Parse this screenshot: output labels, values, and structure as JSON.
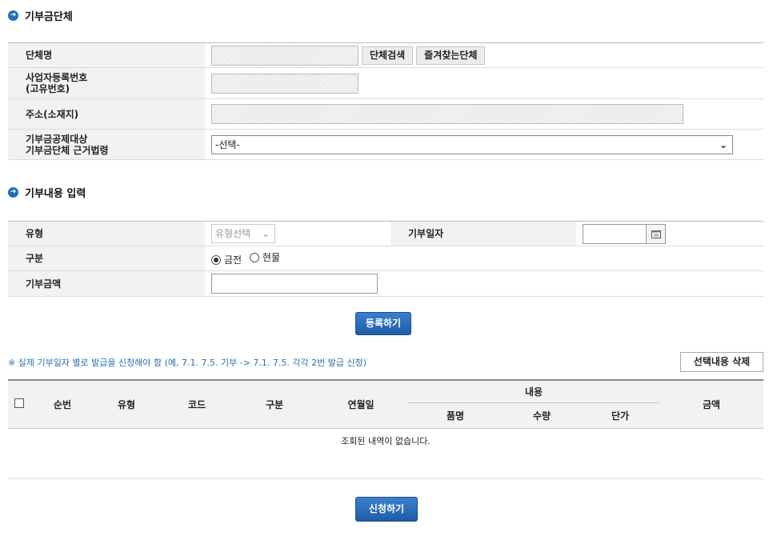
{
  "org_section": {
    "title": "기부금단체",
    "org_name_label": "단체명",
    "search_button": "단체검색",
    "favorites_button": "즐겨찾는단체",
    "biz_no_label_1": "사업자등록번호",
    "biz_no_label_2": "(고유번호)",
    "address_label": "주소(소재지)",
    "legal_basis_label_1": "기부금공제대상",
    "legal_basis_label_2": "기부금단체 근거법령",
    "legal_basis_value": "-선택-"
  },
  "donation_section": {
    "title": "기부내용 입력",
    "type_label": "유형",
    "type_placeholder": "유형선택",
    "date_label": "기부일자",
    "category_label": "구분",
    "category_options": [
      "금전",
      "현물"
    ],
    "category_selected": "금전",
    "amount_label": "기부금액",
    "register_button": "등록하기"
  },
  "list_section": {
    "notice": "※ 실제 기부일자 별로 발급을 신청해야 함 (예, 7.1. 7.5. 기부 -> 7.1. 7.5. 각각 2번 발급 신청)",
    "delete_button": "선택내용 삭제",
    "columns": {
      "seq": "순번",
      "type": "유형",
      "code": "코드",
      "category": "구분",
      "date": "연월일",
      "content": "내용",
      "item": "품명",
      "quantity": "수량",
      "unit_price": "단가",
      "amount": "금액"
    },
    "empty_message": "조회된 내역이 없습니다."
  },
  "apply_button": "신청하기",
  "colors": {
    "accent": "#1f6fb8",
    "notice": "#2d6fb0",
    "header_bg": "#f2f2f2"
  }
}
